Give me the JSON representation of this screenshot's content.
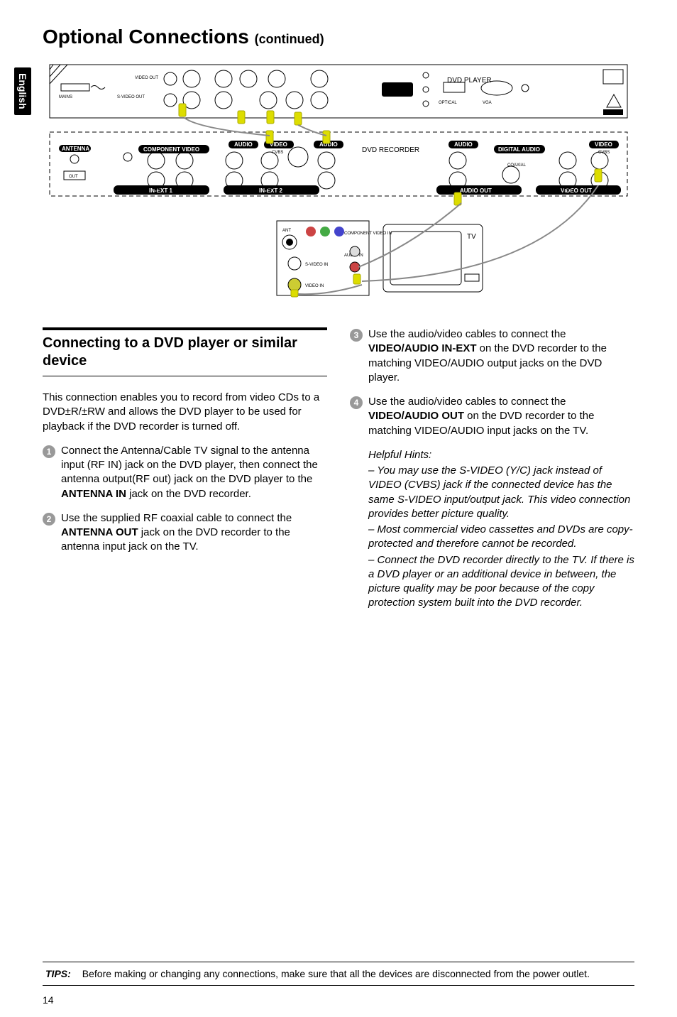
{
  "side_tab": "English",
  "title_main": "Optional Connections",
  "title_sub": "(continued)",
  "diagram": {
    "dvd_player": "DVD PLAYER",
    "dvd_recorder": "DVD RECORDER",
    "tv": "TV",
    "labels": {
      "video_out": "VIDEO OUT",
      "svideo_out": "S-VIDEO OUT",
      "mains": "MAINS",
      "optical": "OPTICAL",
      "vga": "VGA",
      "coaxial": "COAXIAL",
      "antenna": "ANTENNA",
      "out": "OUT",
      "component_video": "COMPONENT VIDEO",
      "in_ext1": "IN-EXT 1",
      "in_ext2": "IN-EXT 2",
      "audio_out": "AUDIO OUT",
      "video_out_bar": "VIDEO OUT",
      "digital_audio": "DIGITAL AUDIO",
      "audio": "AUDIO",
      "video": "VIDEO",
      "cvbs": "CVBS",
      "ant": "ANT",
      "component_video_in": "COMPONENT VIDEO IN",
      "svideo_in": "S-VIDEO IN",
      "video_in": "VIDEO IN",
      "audio_in": "AUDIO IN"
    }
  },
  "section_heading": "Connecting to a DVD player or similar device",
  "intro_para": "This connection enables you to record from video CDs to a DVD±R/±RW and allows the DVD player to be used for playback if the DVD recorder is turned off.",
  "steps": {
    "s1": "Connect the Antenna/Cable TV signal to the antenna input (RF IN) jack on the DVD player, then connect the antenna output(RF out) jack on the DVD player  to the ANTENNA IN jack on the DVD recorder.",
    "s1_pre": "Connect the Antenna/Cable TV signal to the antenna input (RF IN) jack on the DVD player, then connect the antenna output(RF out) jack on the DVD player  to the ",
    "s1_bold": "ANTENNA IN",
    "s1_post": " jack on the DVD recorder.",
    "s2_pre": "Use the supplied RF coaxial cable to connect the ",
    "s2_bold": "ANTENNA OUT",
    "s2_post": " jack on the DVD recorder to the antenna input jack on the TV.",
    "s3_pre": "Use the audio/video cables to connect the ",
    "s3_bold": "VIDEO/AUDIO IN-EXT",
    "s3_post": " on the DVD recorder to the matching VIDEO/AUDIO output jacks on the DVD player.",
    "s4_pre": "Use the audio/video cables to connect the ",
    "s4_bold": "VIDEO/AUDIO OUT",
    "s4_post": " on the DVD recorder to the matching VIDEO/AUDIO input jacks on the TV."
  },
  "hints_heading": "Helpful Hints:",
  "hints": {
    "h1": "– You may use the S-VIDEO (Y/C) jack instead of VIDEO (CVBS) jack if the connected device has the same S-VIDEO input/output jack. This video connection provides better picture quality.",
    "h2": "– Most commercial video cassettes and DVDs are copy-protected and therefore cannot be recorded.",
    "h3": "– Connect the DVD recorder directly to the TV. If there is a DVD player or an additional device in between, the picture quality may be poor because of the copy protection system built into the DVD recorder."
  },
  "tips_label": "TIPS:",
  "tips_text": "Before making or changing any connections, make sure that all the devices are disconnected from the power outlet.",
  "page_number": "14",
  "step_nums": {
    "n1": "1",
    "n2": "2",
    "n3": "3",
    "n4": "4"
  }
}
